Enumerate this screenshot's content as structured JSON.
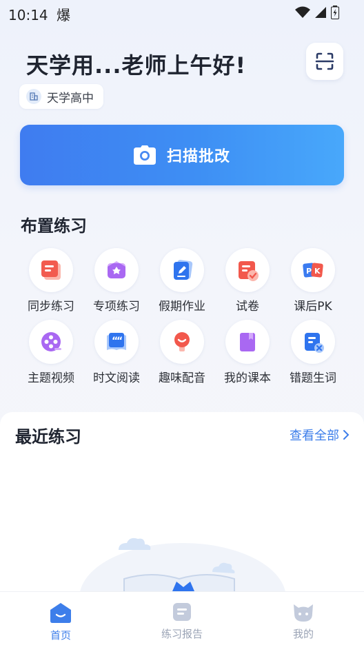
{
  "status_bar": {
    "time": "10:14",
    "extra_glyph": "爆"
  },
  "header": {
    "greeting": "天学用...老师上午好!",
    "school": "天学高中"
  },
  "scan_button": {
    "label": "扫描批改"
  },
  "assign_section": {
    "title": "布置练习",
    "items": [
      {
        "label": "同步练习",
        "icon": "sync-practice-icon"
      },
      {
        "label": "专项练习",
        "icon": "special-practice-icon"
      },
      {
        "label": "假期作业",
        "icon": "holiday-homework-icon"
      },
      {
        "label": "试卷",
        "icon": "exam-paper-icon"
      },
      {
        "label": "课后PK",
        "icon": "pk-icon"
      },
      {
        "label": "主题视频",
        "icon": "video-icon"
      },
      {
        "label": "时文阅读",
        "icon": "reading-icon"
      },
      {
        "label": "趣味配音",
        "icon": "dubbing-icon"
      },
      {
        "label": "我的课本",
        "icon": "textbook-icon"
      },
      {
        "label": "错题生词",
        "icon": "wrong-words-icon"
      }
    ]
  },
  "recent": {
    "title": "最近练习",
    "more": "查看全部"
  },
  "tabs": [
    {
      "label": "首页",
      "icon": "home-icon",
      "active": true
    },
    {
      "label": "练习报告",
      "icon": "report-icon",
      "active": false
    },
    {
      "label": "我的",
      "icon": "profile-icon",
      "active": false
    }
  ],
  "colors": {
    "accent": "#3d7eea",
    "scan_gradient_start": "#3f7cf0",
    "scan_gradient_end": "#48a8fb"
  }
}
